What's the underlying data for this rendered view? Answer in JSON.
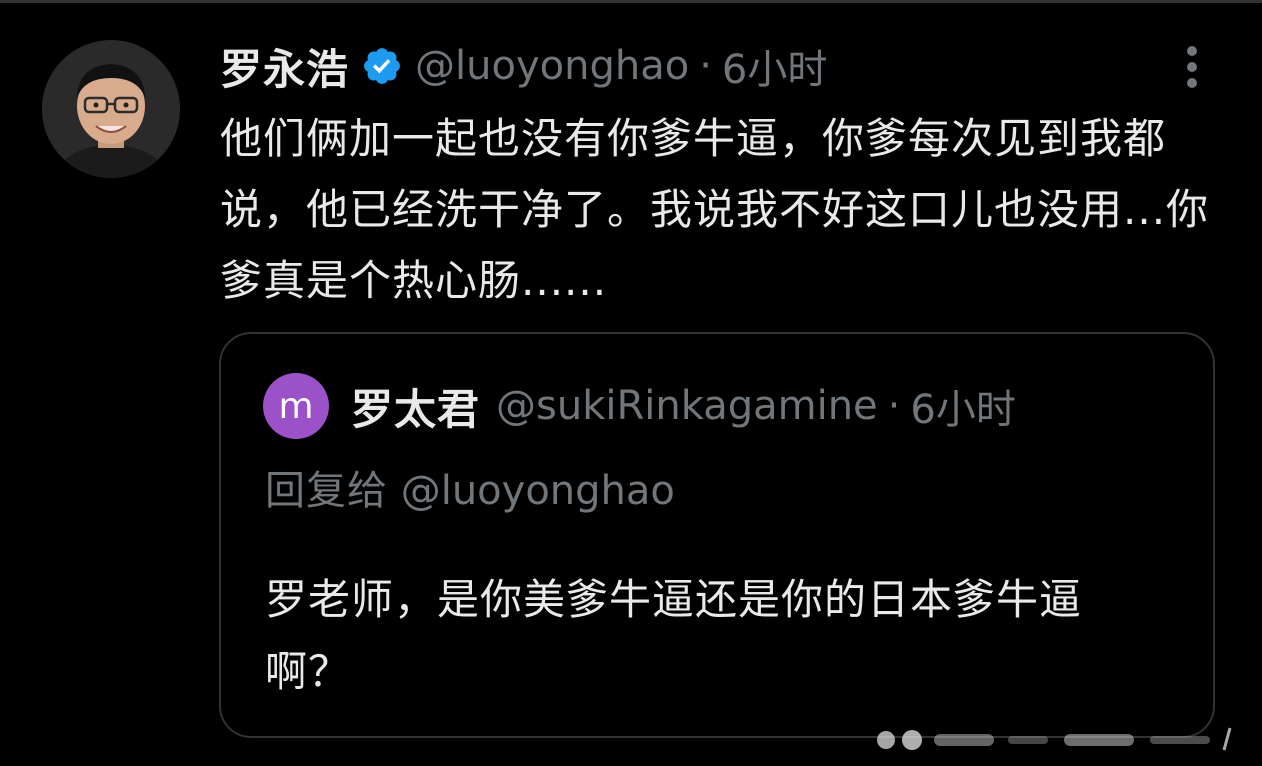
{
  "tweet": {
    "author": {
      "display_name": "罗永浩",
      "handle": "@luoyonghao",
      "verified": true,
      "verified_icon": "verified-badge-icon"
    },
    "separator": "·",
    "time": "6小时",
    "text": "他们俩加一起也没有你爹牛逼，你爹每次见到我都说，他已经洗干净了。我说我不好这口儿也没用...你爹真是个热心肠......",
    "more_icon": "more-vertical-icon"
  },
  "quote": {
    "avatar_letter": "m",
    "avatar_color": "#9b51c7",
    "author": {
      "display_name": "罗太君",
      "handle": "@sukiRinkagamine"
    },
    "separator": "·",
    "time": "6小时",
    "reply_prefix": "回复给",
    "reply_to": "@luoyonghao",
    "text": "罗老师，是你美爹牛逼还是你的日本爹牛逼啊？"
  },
  "colors": {
    "background": "#000000",
    "primary_text": "#e7e9ea",
    "secondary_text": "#71767b",
    "border": "#2f3336",
    "verified_blue": "#1d9bf0"
  }
}
